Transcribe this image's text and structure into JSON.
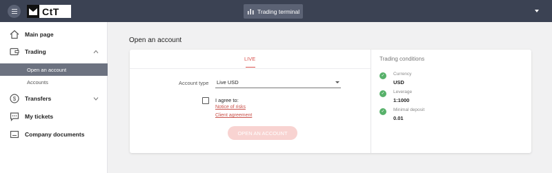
{
  "topbar": {
    "logo_text": "CtT",
    "terminal_label": "Trading terminal"
  },
  "sidebar": {
    "items": [
      {
        "label": "Main page"
      },
      {
        "label": "Trading"
      },
      {
        "label": "Transfers"
      },
      {
        "label": "My tickets"
      },
      {
        "label": "Company documents"
      }
    ],
    "trading_sub": [
      {
        "label": "Open an account"
      },
      {
        "label": "Accounts"
      }
    ]
  },
  "main": {
    "title": "Open an account",
    "tab_live": "LIVE",
    "account_type_label": "Account type",
    "account_type_value": "Live USD",
    "agree_label": "I agree to:",
    "link_risks": "Notice of risks",
    "link_agreement": "Client agreement",
    "open_button": "OPEN AN ACCOUNT"
  },
  "conditions": {
    "title": "Trading conditions",
    "items": [
      {
        "label": "Currency",
        "value": "USD"
      },
      {
        "label": "Leverage",
        "value": "1:1000"
      },
      {
        "label": "Minimal deposit",
        "value": "0.01"
      }
    ]
  },
  "colors": {
    "topbar": "#3b4253",
    "accent": "#d9534f",
    "active_sub": "#6c7280",
    "check_green": "#57b16a"
  }
}
